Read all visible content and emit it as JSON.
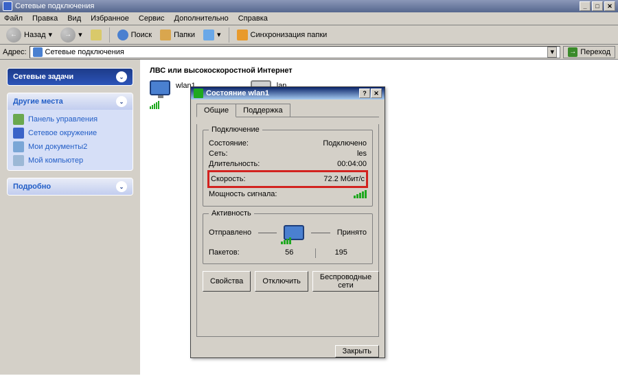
{
  "window": {
    "title": "Сетевые подключения"
  },
  "menu": {
    "file": "Файл",
    "edit": "Правка",
    "view": "Вид",
    "favorites": "Избранное",
    "tools": "Сервис",
    "extra": "Дополнительно",
    "help": "Справка"
  },
  "toolbar": {
    "back": "Назад",
    "forward": "",
    "search": "Поиск",
    "folders": "Папки",
    "sync": "Синхронизация папки"
  },
  "addressbar": {
    "label": "Адрес:",
    "value": "Сетевые подключения",
    "go": "Переход"
  },
  "sidebar": {
    "tasks": {
      "title": "Сетевые задачи"
    },
    "places": {
      "title": "Другие места",
      "items": [
        {
          "icon": "panel-icon",
          "label": "Панель управления"
        },
        {
          "icon": "network-icon",
          "label": "Сетевое окружение"
        },
        {
          "icon": "folder-icon",
          "label": "Мои документы2"
        },
        {
          "icon": "computer-icon",
          "label": "Мой компьютер"
        }
      ]
    },
    "details": {
      "title": "Подробно"
    }
  },
  "main": {
    "section": "ЛВС или высокоскоростной Интернет",
    "conns": [
      {
        "name": "wlan1"
      },
      {
        "name": "lan"
      }
    ]
  },
  "dialog": {
    "title": "Состояние wlan1",
    "tabs": {
      "general": "Общие",
      "support": "Поддержка"
    },
    "group_conn": {
      "legend": "Подключение",
      "state_lbl": "Состояние:",
      "state_val": "Подключено",
      "net_lbl": "Сеть:",
      "net_val": "les",
      "dur_lbl": "Длительность:",
      "dur_val": "00:04:00",
      "speed_lbl": "Скорость:",
      "speed_val": "72.2 Мбит/с",
      "signal_lbl": "Мощность сигнала:"
    },
    "group_act": {
      "legend": "Активность",
      "sent": "Отправлено",
      "recv": "Принято",
      "pkts_lbl": "Пакетов:",
      "sent_val": "56",
      "recv_val": "195"
    },
    "buttons": {
      "props": "Свойства",
      "disable": "Отключить",
      "wnets": "Беспроводные сети",
      "close": "Закрыть"
    }
  }
}
